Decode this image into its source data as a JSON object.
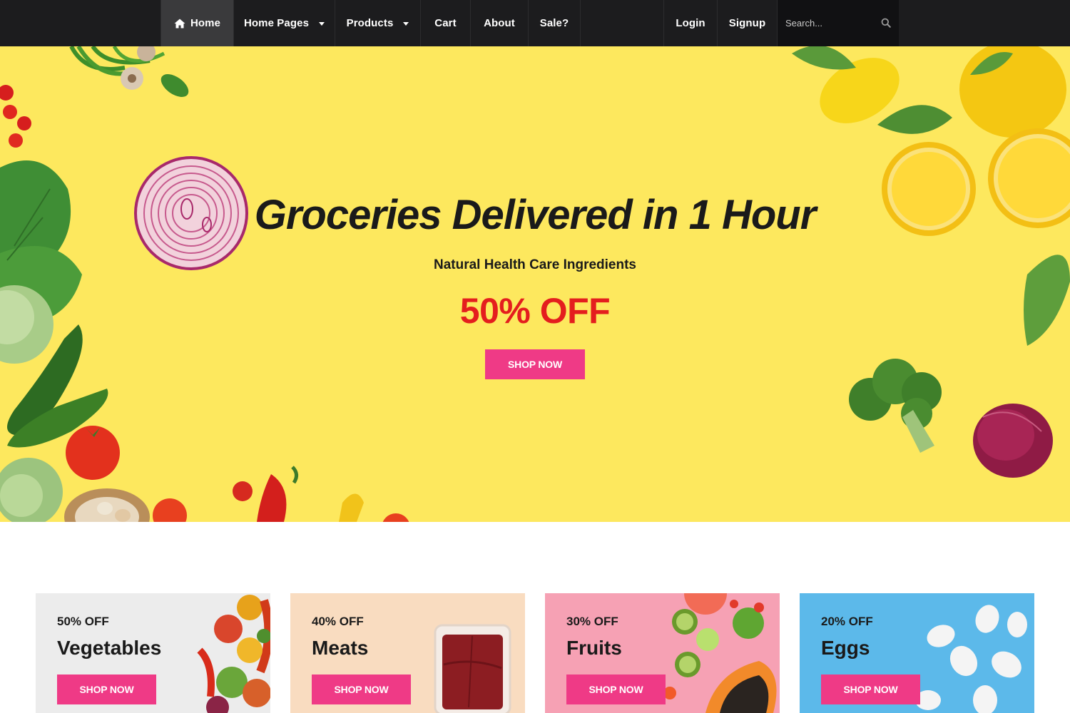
{
  "nav": {
    "home": "Home",
    "home_pages": "Home Pages",
    "products": "Products",
    "cart": "Cart",
    "about": "About",
    "sale": "Sale?",
    "login": "Login",
    "signup": "Signup",
    "search_placeholder": "Search..."
  },
  "icons": {
    "home": "home-icon",
    "search": "search-icon",
    "dropdown": "caret-down-icon"
  },
  "hero": {
    "title": "Groceries Delivered in 1 Hour",
    "subtitle": "Natural Health Care Ingredients",
    "discount": "50% OFF",
    "button": "SHOP NOW"
  },
  "cards": [
    {
      "discount": "50% OFF",
      "title": "Vegetables",
      "button": "SHOP NOW",
      "bg": "#ececec"
    },
    {
      "discount": "40% OFF",
      "title": "Meats",
      "button": "SHOP NOW",
      "bg": "#f9dcc0"
    },
    {
      "discount": "30% OFF",
      "title": "Fruits",
      "button": "SHOP NOW",
      "bg": "#f6a1b4"
    },
    {
      "discount": "20% OFF",
      "title": "Eggs",
      "button": "SHOP NOW",
      "bg": "#5cb9ea"
    }
  ],
  "colors": {
    "nav_bg": "#1c1c1e",
    "hero_bg": "#fde85e",
    "accent": "#ef3a86",
    "discount_red": "#e41e1e"
  }
}
